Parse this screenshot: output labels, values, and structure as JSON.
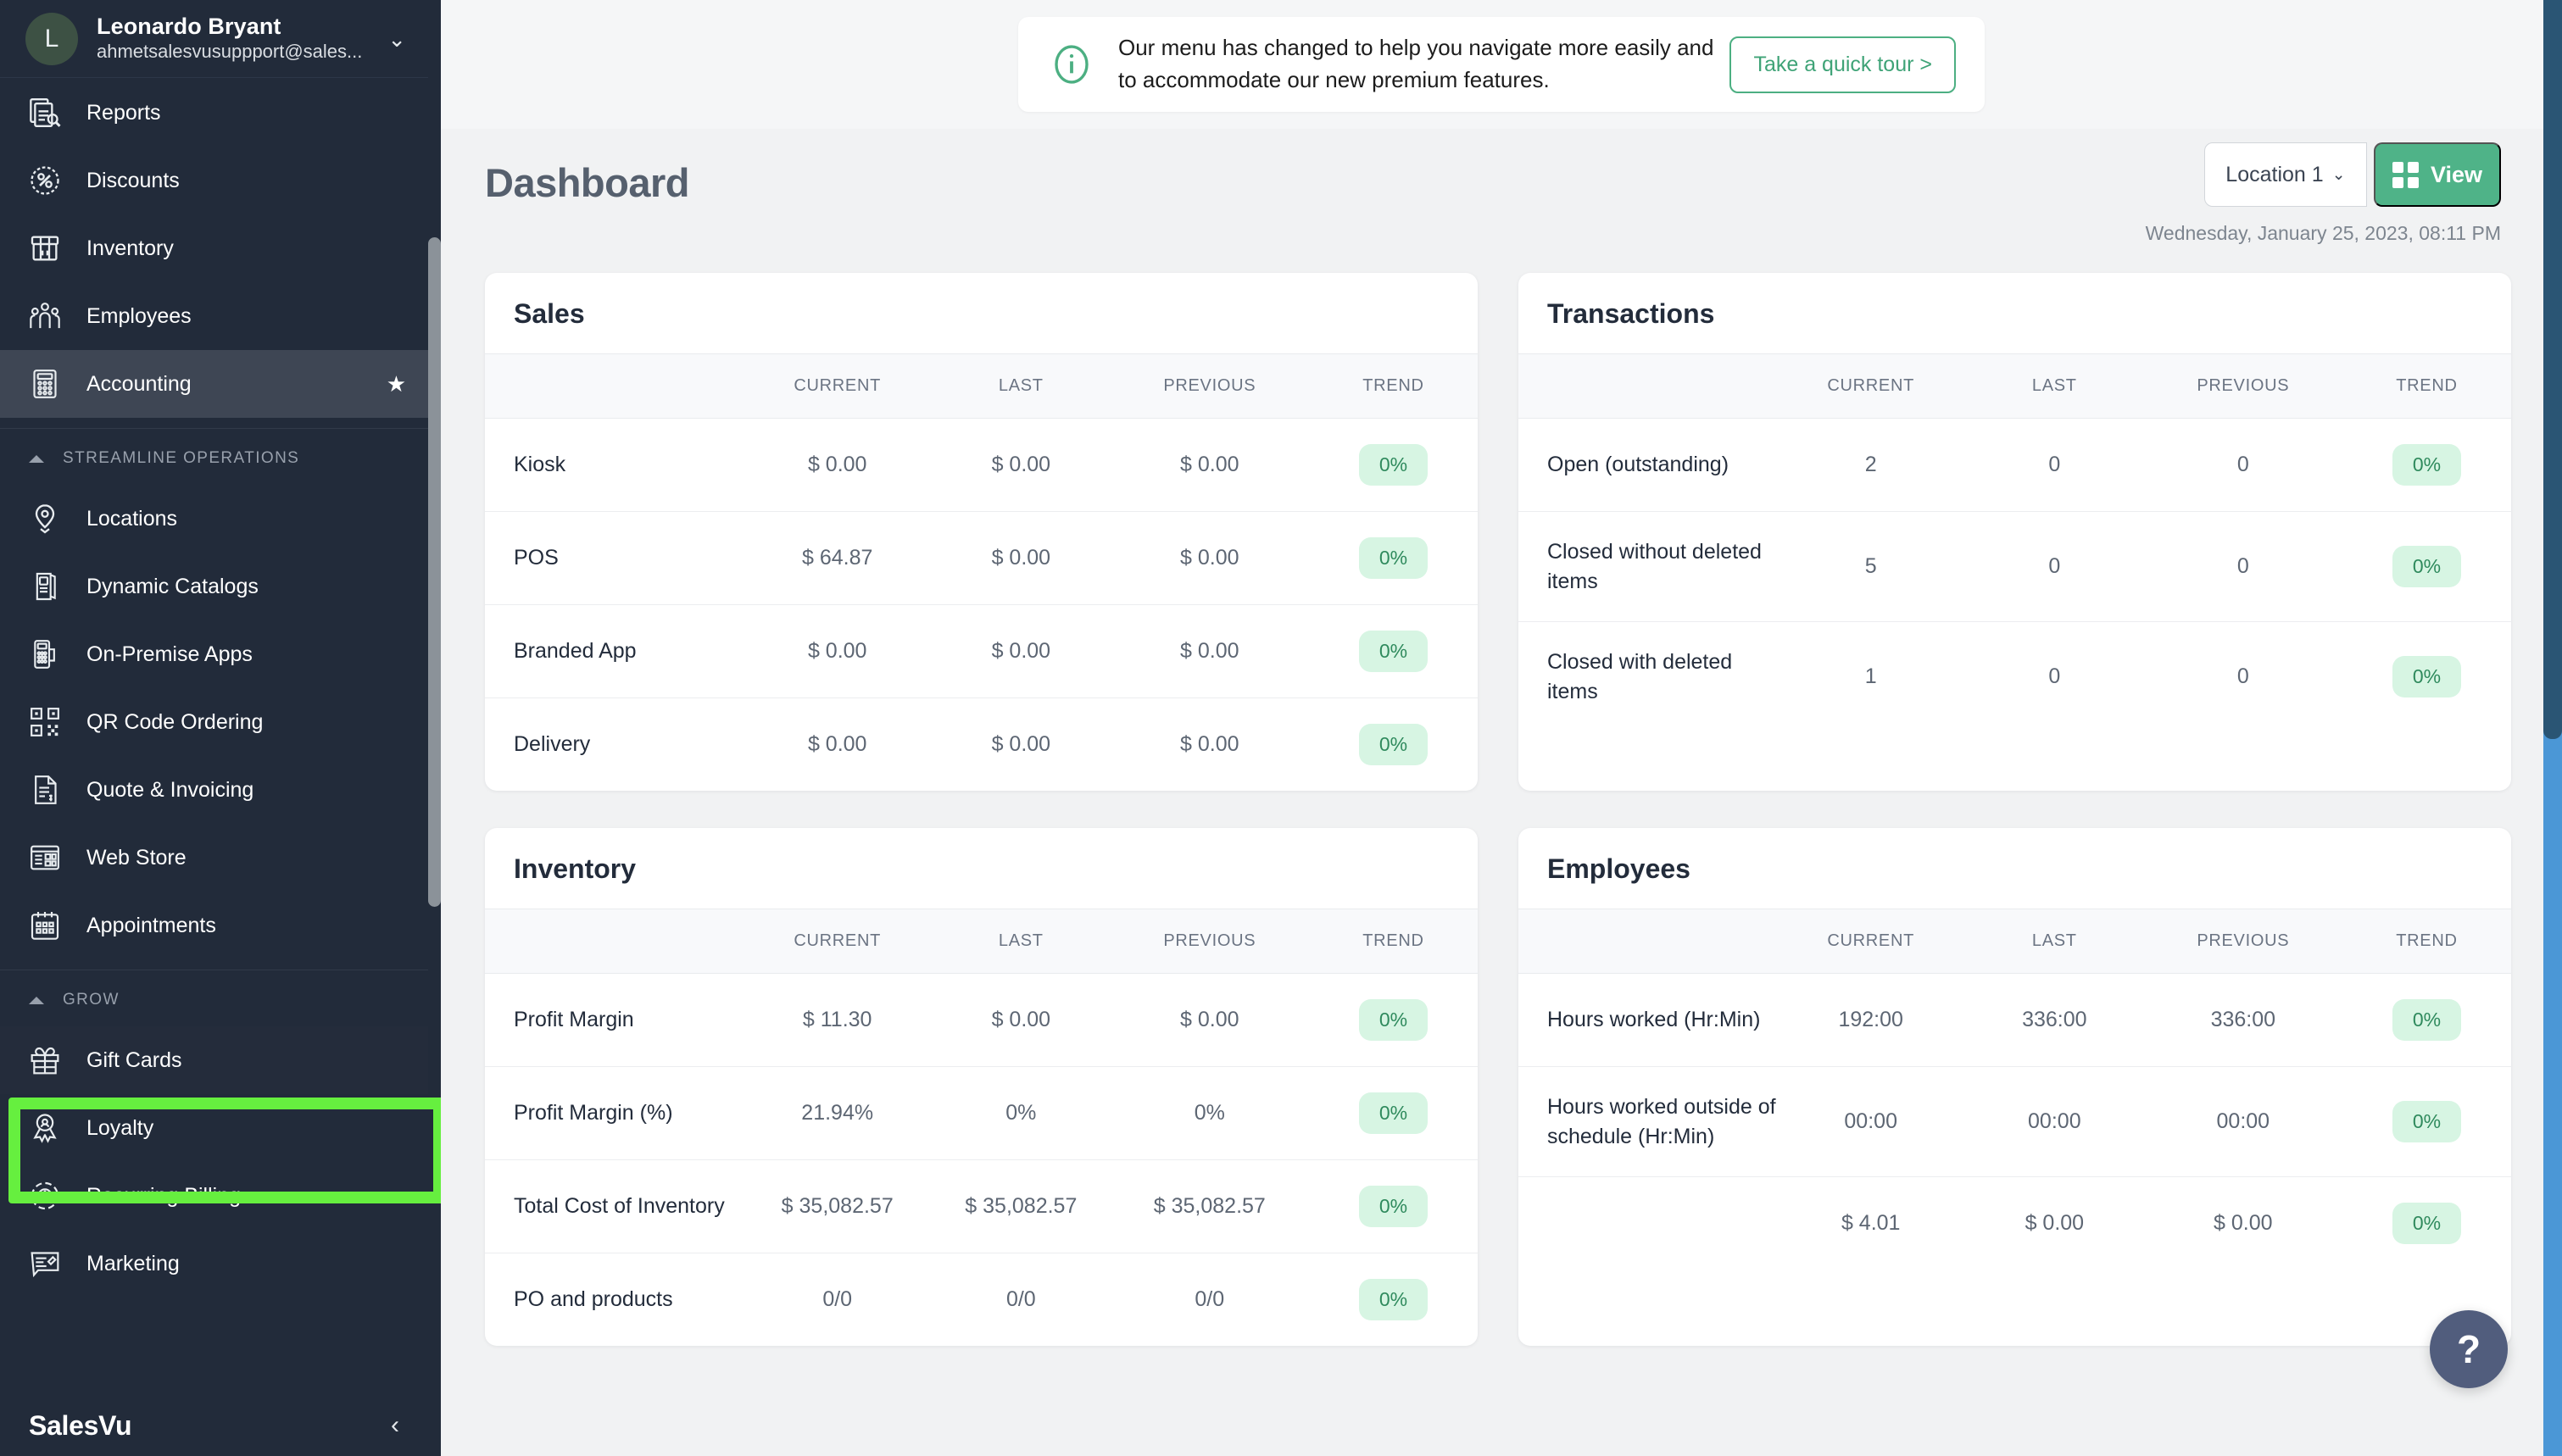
{
  "sidebar": {
    "profile": {
      "avatar_initial": "L",
      "name": "Leonardo Bryant",
      "email": "ahmetsalesvusuppport@sales...",
      "chevron": "chevron-down-icon"
    },
    "top_items": [
      {
        "label": "Reports",
        "icon": "reports-icon"
      },
      {
        "label": "Discounts",
        "icon": "discount-percent-icon"
      },
      {
        "label": "Inventory",
        "icon": "inventory-box-icon"
      },
      {
        "label": "Employees",
        "icon": "employees-icon"
      },
      {
        "label": "Accounting",
        "icon": "calculator-icon",
        "starred": true,
        "active": true
      }
    ],
    "groups": [
      {
        "label": "STREAMLINE OPERATIONS",
        "items": [
          {
            "label": "Locations",
            "icon": "map-pin-icon"
          },
          {
            "label": "Dynamic Catalogs",
            "icon": "catalog-icon"
          },
          {
            "label": "On-Premise Apps",
            "icon": "terminal-device-icon"
          },
          {
            "label": "QR Code Ordering",
            "icon": "qr-code-icon"
          },
          {
            "label": "Quote & Invoicing",
            "icon": "invoice-doc-icon"
          },
          {
            "label": "Web Store",
            "icon": "web-store-icon"
          },
          {
            "label": "Appointments",
            "icon": "calendar-icon"
          }
        ]
      },
      {
        "label": "GROW",
        "items": [
          {
            "label": "Gift Cards",
            "icon": "gift-icon",
            "highlighted": true
          },
          {
            "label": "Loyalty",
            "icon": "loyalty-badge-icon"
          },
          {
            "label": "Recurring Billing",
            "icon": "recurring-billing-icon"
          },
          {
            "label": "Marketing",
            "icon": "marketing-megaphone-icon"
          }
        ]
      }
    ],
    "footer": {
      "brand": "SalesVu",
      "collapse_icon": "chevron-left-icon"
    }
  },
  "banner": {
    "icon": "info-circle-icon",
    "text": "Our menu has changed to help you navigate more easily and to accommodate our new premium features.",
    "cta_label": "Take a quick tour >"
  },
  "header": {
    "title": "Dashboard",
    "location_label": "Location 1",
    "location_chevron": "chevron-down-icon",
    "view_label": "View",
    "view_icon": "grid-icon",
    "timestamp": "Wednesday, January 25, 2023, 08:11 PM"
  },
  "colors": {
    "accent_green": "#4fb388",
    "pill_bg": "#d7f5e3",
    "pill_text": "#2f8a5d",
    "sidebar_bg": "#222b3a",
    "highlight_green": "#66ef3f",
    "page_bg": "#f1f2f3"
  },
  "chart_data": [
    {
      "type": "table",
      "title": "Sales",
      "columns": [
        "",
        "CURRENT",
        "LAST",
        "PREVIOUS",
        "TREND"
      ],
      "rows": [
        {
          "label": "Kiosk",
          "current": "$ 0.00",
          "last": "$ 0.00",
          "previous": "$ 0.00",
          "trend": "0%"
        },
        {
          "label": "POS",
          "current": "$ 64.87",
          "last": "$ 0.00",
          "previous": "$ 0.00",
          "trend": "0%"
        },
        {
          "label": "Branded App",
          "current": "$ 0.00",
          "last": "$ 0.00",
          "previous": "$ 0.00",
          "trend": "0%"
        },
        {
          "label": "Delivery",
          "current": "$ 0.00",
          "last": "$ 0.00",
          "previous": "$ 0.00",
          "trend": "0%"
        }
      ]
    },
    {
      "type": "table",
      "title": "Transactions",
      "columns": [
        "",
        "CURRENT",
        "LAST",
        "PREVIOUS",
        "TREND"
      ],
      "rows": [
        {
          "label": "Open (outstanding)",
          "current": "2",
          "last": "0",
          "previous": "0",
          "trend": "0%"
        },
        {
          "label": "Closed without deleted items",
          "current": "5",
          "last": "0",
          "previous": "0",
          "trend": "0%"
        },
        {
          "label": "Closed with deleted items",
          "current": "1",
          "last": "0",
          "previous": "0",
          "trend": "0%"
        }
      ]
    },
    {
      "type": "table",
      "title": "Inventory",
      "columns": [
        "",
        "CURRENT",
        "LAST",
        "PREVIOUS",
        "TREND"
      ],
      "rows": [
        {
          "label": "Profit Margin",
          "current": "$ 11.30",
          "last": "$ 0.00",
          "previous": "$ 0.00",
          "trend": "0%"
        },
        {
          "label": "Profit Margin (%)",
          "current": "21.94%",
          "last": "0%",
          "previous": "0%",
          "trend": "0%"
        },
        {
          "label": "Total Cost of Inventory",
          "current": "$ 35,082.57",
          "last": "$ 35,082.57",
          "previous": "$ 35,082.57",
          "trend": "0%"
        },
        {
          "label": "PO and products",
          "current": "0/0",
          "last": "0/0",
          "previous": "0/0",
          "trend": "0%"
        }
      ]
    },
    {
      "type": "table",
      "title": "Employees",
      "columns": [
        "",
        "CURRENT",
        "LAST",
        "PREVIOUS",
        "TREND"
      ],
      "rows": [
        {
          "label": "Hours worked (Hr:Min)",
          "current": "192:00",
          "last": "336:00",
          "previous": "336:00",
          "trend": "0%"
        },
        {
          "label": "Hours worked outside of schedule (Hr:Min)",
          "current": "00:00",
          "last": "00:00",
          "previous": "00:00",
          "trend": "0%"
        },
        {
          "label": "",
          "current": "$ 4.01",
          "last": "$ 0.00",
          "previous": "$ 0.00",
          "trend": "0%"
        }
      ]
    }
  ],
  "cards": {
    "sales": {
      "title": "Sales",
      "columns": {
        "label": "",
        "current": "CURRENT",
        "last": "LAST",
        "previous": "PREVIOUS",
        "trend": "TREND"
      },
      "rows": [
        {
          "label": "Kiosk",
          "current": "$ 0.00",
          "last": "$ 0.00",
          "previous": "$ 0.00",
          "trend": "0%"
        },
        {
          "label": "POS",
          "current": "$ 64.87",
          "last": "$ 0.00",
          "previous": "$ 0.00",
          "trend": "0%"
        },
        {
          "label": "Branded App",
          "current": "$ 0.00",
          "last": "$ 0.00",
          "previous": "$ 0.00",
          "trend": "0%"
        },
        {
          "label": "Delivery",
          "current": "$ 0.00",
          "last": "$ 0.00",
          "previous": "$ 0.00",
          "trend": "0%"
        }
      ]
    },
    "transactions": {
      "title": "Transactions",
      "columns": {
        "label": "",
        "current": "CURRENT",
        "last": "LAST",
        "previous": "PREVIOUS",
        "trend": "TREND"
      },
      "rows": [
        {
          "label": "Open (outstanding)",
          "current": "2",
          "last": "0",
          "previous": "0",
          "trend": "0%"
        },
        {
          "label": "Closed without deleted items",
          "current": "5",
          "last": "0",
          "previous": "0",
          "trend": "0%"
        },
        {
          "label": "Closed with deleted items",
          "current": "1",
          "last": "0",
          "previous": "0",
          "trend": "0%"
        }
      ]
    },
    "inventory": {
      "title": "Inventory",
      "columns": {
        "label": "",
        "current": "CURRENT",
        "last": "LAST",
        "previous": "PREVIOUS",
        "trend": "TREND"
      },
      "rows": [
        {
          "label": "Profit Margin",
          "current": "$ 11.30",
          "last": "$ 0.00",
          "previous": "$ 0.00",
          "trend": "0%"
        },
        {
          "label": "Profit Margin (%)",
          "current": "21.94%",
          "last": "0%",
          "previous": "0%",
          "trend": "0%"
        },
        {
          "label": "Total Cost of Inventory",
          "current": "$ 35,082.57",
          "last": "$ 35,082.57",
          "previous": "$ 35,082.57",
          "trend": "0%"
        },
        {
          "label": "PO and products",
          "current": "0/0",
          "last": "0/0",
          "previous": "0/0",
          "trend": "0%"
        }
      ]
    },
    "employees": {
      "title": "Employees",
      "columns": {
        "label": "",
        "current": "CURRENT",
        "last": "LAST",
        "previous": "PREVIOUS",
        "trend": "TREND"
      },
      "rows": [
        {
          "label": "Hours worked (Hr:Min)",
          "current": "192:00",
          "last": "336:00",
          "previous": "336:00",
          "trend": "0%"
        },
        {
          "label": "Hours worked outside of schedule (Hr:Min)",
          "current": "00:00",
          "last": "00:00",
          "previous": "00:00",
          "trend": "0%"
        },
        {
          "label": "",
          "current": "$ 4.01",
          "last": "$ 0.00",
          "previous": "$ 0.00",
          "trend": "0%"
        }
      ]
    }
  },
  "help": {
    "label": "?"
  }
}
